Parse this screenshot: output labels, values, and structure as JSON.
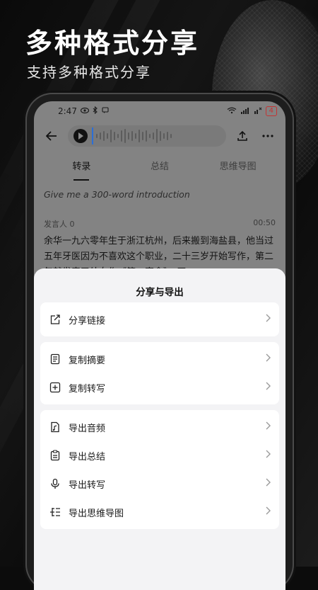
{
  "promo": {
    "headline": "多种格式分享",
    "subline": "支持多种格式分享"
  },
  "status": {
    "time": "2:47",
    "battery": "4"
  },
  "tabs": [
    {
      "label": "转录",
      "active": true
    },
    {
      "label": "总结",
      "active": false
    },
    {
      "label": "思维导图",
      "active": false
    }
  ],
  "prompt": "Give me a 300-word introduction",
  "speaker": {
    "name": "发言人 0",
    "time": "00:50"
  },
  "transcript": "余华一九六零年生于浙江杭州，后来搬到海盐县，他当过五年牙医因为不喜欢这个职业，二十三岁开始写作，第二年就发表了处女作《第一宿舍》。四",
  "sheet": {
    "title": "分享与导出",
    "groups": [
      [
        {
          "label": "分享链接",
          "icon": "share-link-icon"
        }
      ],
      [
        {
          "label": "复制摘要",
          "icon": "copy-summary-icon"
        },
        {
          "label": "复制转写",
          "icon": "copy-transcript-icon"
        }
      ],
      [
        {
          "label": "导出音频",
          "icon": "export-audio-icon"
        },
        {
          "label": "导出总结",
          "icon": "export-summary-icon"
        },
        {
          "label": "导出转写",
          "icon": "export-transcript-icon"
        },
        {
          "label": "导出思维导图",
          "icon": "export-mindmap-icon"
        }
      ]
    ]
  },
  "colors": {
    "accent_wave": "#2c6fd6",
    "battery": "#c43333",
    "sheet_bg": "#f3f3f5"
  }
}
